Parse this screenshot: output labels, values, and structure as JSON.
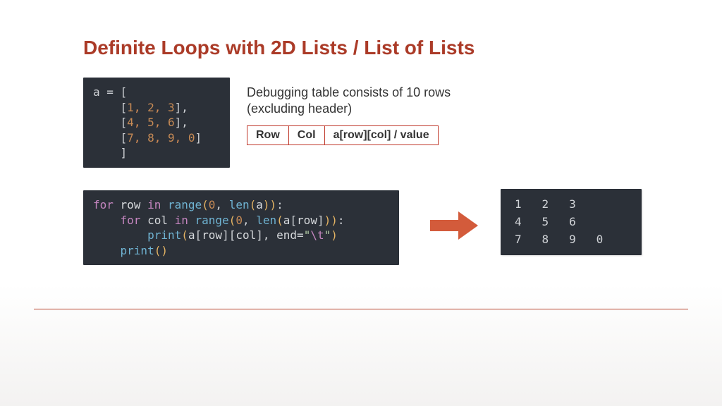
{
  "title": "Definite Loops with 2D Lists / List of Lists",
  "code_a": {
    "tokens": [
      [
        [
          "a = [",
          "default"
        ]
      ],
      [
        [
          "    [",
          "default"
        ],
        [
          "1",
          "num"
        ],
        [
          ", ",
          "orange"
        ],
        [
          "2",
          "num"
        ],
        [
          ", ",
          "orange"
        ],
        [
          "3",
          "num"
        ],
        [
          "],",
          "default"
        ]
      ],
      [
        [
          "    [",
          "default"
        ],
        [
          "4",
          "num"
        ],
        [
          ", ",
          "orange"
        ],
        [
          "5",
          "num"
        ],
        [
          ", ",
          "orange"
        ],
        [
          "6",
          "num"
        ],
        [
          "],",
          "default"
        ]
      ],
      [
        [
          "    [",
          "default"
        ],
        [
          "7",
          "num"
        ],
        [
          ", ",
          "orange"
        ],
        [
          "8",
          "num"
        ],
        [
          ", ",
          "orange"
        ],
        [
          "9",
          "num"
        ],
        [
          ", ",
          "orange"
        ],
        [
          "0",
          "num"
        ],
        [
          "]",
          "default"
        ]
      ],
      [
        [
          "    ]",
          "default"
        ]
      ]
    ]
  },
  "debug_note_line1": "Debugging table consists of 10 rows",
  "debug_note_line2": "(excluding header)",
  "table_headers": [
    "Row",
    "Col",
    "a[row][col] / value"
  ],
  "code_loop": {
    "tokens": [
      [
        [
          "for ",
          "kw"
        ],
        [
          "row ",
          "ident"
        ],
        [
          "in ",
          "kw"
        ],
        [
          "range",
          "builtin"
        ],
        [
          "(",
          "paren"
        ],
        [
          "0",
          "num"
        ],
        [
          ", ",
          "comma"
        ],
        [
          "len",
          "builtin"
        ],
        [
          "(",
          "paren"
        ],
        [
          "a",
          "ident"
        ],
        [
          "))",
          ""
        ],
        [
          ":",
          "default"
        ]
      ],
      [
        [
          "    ",
          "default"
        ],
        [
          "for ",
          "kw"
        ],
        [
          "col ",
          "ident"
        ],
        [
          "in ",
          "kw"
        ],
        [
          "range",
          "builtin"
        ],
        [
          "(",
          "paren"
        ],
        [
          "0",
          "num"
        ],
        [
          ", ",
          "comma"
        ],
        [
          "len",
          "builtin"
        ],
        [
          "(",
          "paren"
        ],
        [
          "a",
          "ident"
        ],
        [
          "[",
          "default"
        ],
        [
          "row",
          "ident"
        ],
        [
          "]",
          "default"
        ],
        [
          "))",
          ""
        ],
        [
          ":",
          "default"
        ]
      ],
      [
        [
          "        ",
          "default"
        ],
        [
          "print",
          "builtin"
        ],
        [
          "(",
          "paren"
        ],
        [
          "a",
          "ident"
        ],
        [
          "[",
          "default"
        ],
        [
          "row",
          "ident"
        ],
        [
          "][",
          "default"
        ],
        [
          "col",
          "ident"
        ],
        [
          "]",
          "default"
        ],
        [
          ", ",
          "comma"
        ],
        [
          "end",
          "ident"
        ],
        [
          "=",
          "default"
        ],
        [
          "\"",
          "str"
        ],
        [
          "\\t",
          "esc"
        ],
        [
          "\"",
          "str"
        ],
        [
          ")",
          "paren"
        ]
      ],
      [
        [
          "    ",
          "default"
        ],
        [
          "print",
          "builtin"
        ],
        [
          "()",
          "paren"
        ]
      ]
    ]
  },
  "output_rows": [
    [
      "1",
      "2",
      "3"
    ],
    [
      "4",
      "5",
      "6"
    ],
    [
      "7",
      "8",
      "9",
      "0"
    ]
  ],
  "chart_data": {
    "type": "table",
    "title": "2D list a and nested-loop traversal output",
    "a": [
      [
        1,
        2,
        3
      ],
      [
        4,
        5,
        6
      ],
      [
        7,
        8,
        9,
        0
      ]
    ],
    "debug_table_headers": [
      "Row",
      "Col",
      "a[row][col] / value"
    ],
    "debug_table_rows_expected": 10,
    "printed_output": [
      [
        1,
        2,
        3
      ],
      [
        4,
        5,
        6
      ],
      [
        7,
        8,
        9,
        0
      ]
    ]
  }
}
